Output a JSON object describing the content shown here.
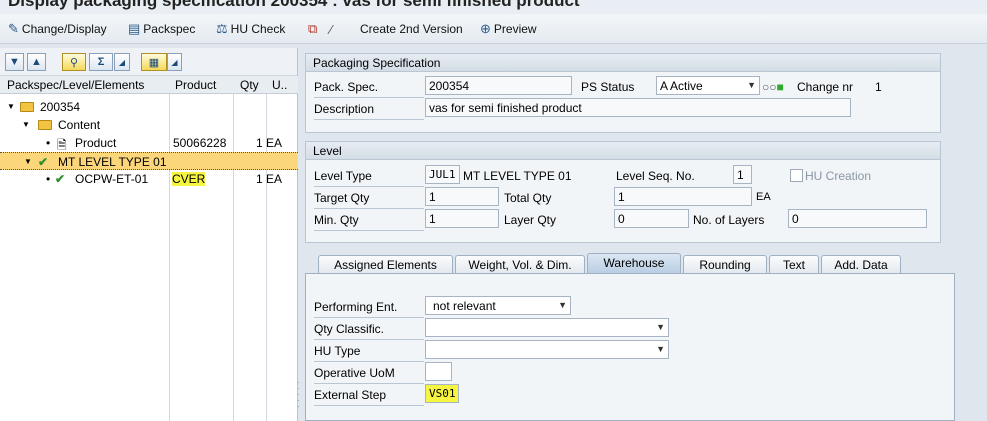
{
  "window": {
    "title": "Display packaging specification 200354 : vas for semi finished product"
  },
  "toolbar": {
    "change_display": "Change/Display",
    "packspec": "Packspec",
    "hu_check": "HU Check",
    "create_2nd_version": "Create 2nd Version",
    "preview": "Preview"
  },
  "tree": {
    "columns": [
      "Packspec/Level/Elements",
      "Product",
      "Qty",
      "U.."
    ],
    "rows": [
      {
        "label": "200354",
        "product": "",
        "qty": ""
      },
      {
        "label": "Content",
        "product": "",
        "qty": ""
      },
      {
        "label": "Product",
        "product": "50066228",
        "qty": "1 EA"
      },
      {
        "label": "MT LEVEL TYPE 01",
        "product": "",
        "qty": ""
      },
      {
        "label": "OCPW-ET-01",
        "product": "CVER",
        "qty": "1 EA"
      }
    ]
  },
  "packaging_spec": {
    "title": "Packaging Specification",
    "pack_spec_label": "Pack. Spec.",
    "pack_spec_value": "200354",
    "ps_status_label": "PS Status",
    "ps_status_value": "A Active",
    "change_nr_label": "Change nr",
    "change_nr_value": "1",
    "description_label": "Description",
    "description_value": "vas for semi finished product"
  },
  "level": {
    "title": "Level",
    "level_type_label": "Level Type",
    "level_type_code": "JUL1",
    "level_type_text": "MT LEVEL TYPE 01",
    "level_seq_label": "Level Seq. No.",
    "level_seq_value": "1",
    "hu_creation_label": "HU Creation",
    "target_qty_label": "Target Qty",
    "target_qty_value": "1",
    "total_qty_label": "Total Qty",
    "total_qty_value": "1",
    "total_qty_unit": "EA",
    "min_qty_label": "Min. Qty",
    "min_qty_value": "1",
    "layer_qty_label": "Layer Qty",
    "layer_qty_value": "0",
    "no_layers_label": "No. of Layers",
    "no_layers_value": "0"
  },
  "tabs": [
    "Assigned Elements",
    "Weight, Vol. & Dim.",
    "Warehouse",
    "Rounding",
    "Text",
    "Add. Data"
  ],
  "warehouse": {
    "performing_ent_label": "Performing Ent.",
    "performing_ent_value": "not relevant",
    "qty_classific_label": "Qty Classific.",
    "qty_classific_value": "",
    "hu_type_label": "HU Type",
    "hu_type_value": "",
    "operative_uom_label": "Operative UoM",
    "operative_uom_value": "",
    "external_step_label": "External Step",
    "external_step_value": "VS01"
  },
  "colors": {
    "highlight": "#f5f542",
    "selection": "#fbd67a",
    "active_tab": "#b8cde3"
  }
}
